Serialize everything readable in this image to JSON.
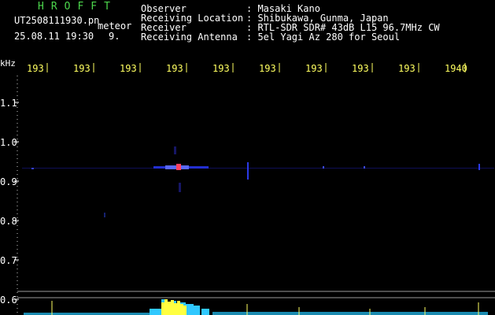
{
  "header": {
    "title": "HROFFT",
    "file_name": "UT2508111930.pn",
    "label_meteor": "meteor",
    "date_time": "25.08.11 19:30",
    "count": "9."
  },
  "station_info": [
    {
      "label": "Observer",
      "value": ": Masaki Kano"
    },
    {
      "label": "Receiving Location",
      "value": ": Shibukawa, Gunma, Japan"
    },
    {
      "label": "Receiver",
      "value": ": RTL-SDR SDR# 43dB L15 96.7MHz CW"
    },
    {
      "label": "Receiving Antenna",
      "value": ": 5el Yagi Az 280 for Seoul"
    }
  ],
  "colors": {
    "title": "#4cd64c",
    "text": "#ffffff",
    "tick_label": "#ffff60",
    "grid": "#2a2ad0",
    "axis_text": "#ffffff"
  },
  "axis": {
    "y_unit": "kHz",
    "x_ticks": [
      "193",
      "193",
      "193",
      "193",
      "193",
      "193",
      "193",
      "193",
      "193",
      "1940"
    ],
    "y_ticks": [
      "1.1",
      "1.0",
      "0.9",
      "0.8",
      "0.7",
      "0.6"
    ]
  }
}
